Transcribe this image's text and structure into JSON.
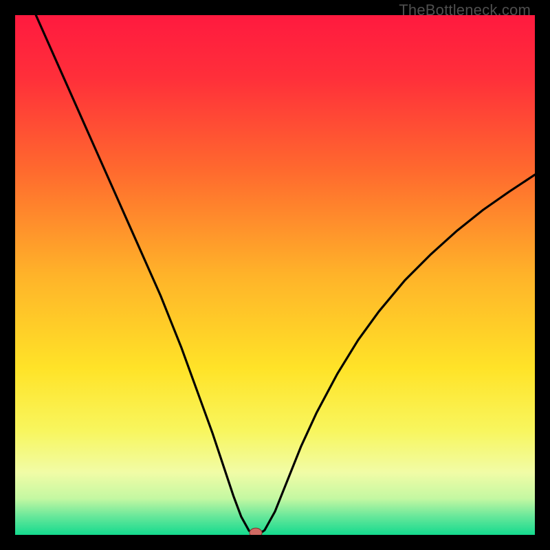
{
  "watermark": "TheBottleneck.com",
  "colors": {
    "gradient_stops": [
      {
        "offset": 0.0,
        "color": "#ff1a3f"
      },
      {
        "offset": 0.12,
        "color": "#ff2f3a"
      },
      {
        "offset": 0.3,
        "color": "#ff6a2e"
      },
      {
        "offset": 0.5,
        "color": "#ffb329"
      },
      {
        "offset": 0.68,
        "color": "#ffe328"
      },
      {
        "offset": 0.8,
        "color": "#f8f65e"
      },
      {
        "offset": 0.88,
        "color": "#f1fca6"
      },
      {
        "offset": 0.93,
        "color": "#c4f8a2"
      },
      {
        "offset": 0.965,
        "color": "#66e79a"
      },
      {
        "offset": 1.0,
        "color": "#14da8e"
      }
    ],
    "curve": "#000000",
    "marker_fill": "#d06a63",
    "marker_stroke": "#7a352f",
    "frame": "#000000"
  },
  "chart_data": {
    "type": "line",
    "title": "",
    "xlabel": "",
    "ylabel": "",
    "xlim": [
      0,
      100
    ],
    "ylim": [
      0,
      100
    ],
    "grid": false,
    "legend": false,
    "series": [
      {
        "name": "bottleneck-curve",
        "x": [
          4,
          6,
          8,
          10,
          12,
          14,
          16,
          18,
          20,
          22,
          24,
          26,
          28,
          30,
          32,
          34,
          36,
          38,
          40,
          42,
          43.5,
          45,
          46,
          47,
          48,
          50,
          52,
          55,
          58,
          62,
          66,
          70,
          75,
          80,
          85,
          90,
          95,
          100
        ],
        "y": [
          100,
          95.5,
          91,
          86.5,
          82,
          77.5,
          73,
          68.5,
          64,
          59.5,
          55,
          50.5,
          46,
          41,
          36,
          30.5,
          25,
          19.5,
          13.5,
          7.5,
          3.5,
          0.8,
          0.2,
          0.2,
          0.9,
          4.5,
          9.5,
          17,
          23.5,
          31,
          37.5,
          43,
          49,
          54,
          58.5,
          62.5,
          66,
          69.3
        ]
      }
    ],
    "marker": {
      "x": 46.3,
      "y": 0.4,
      "rx": 1.2,
      "ry": 0.9
    }
  }
}
